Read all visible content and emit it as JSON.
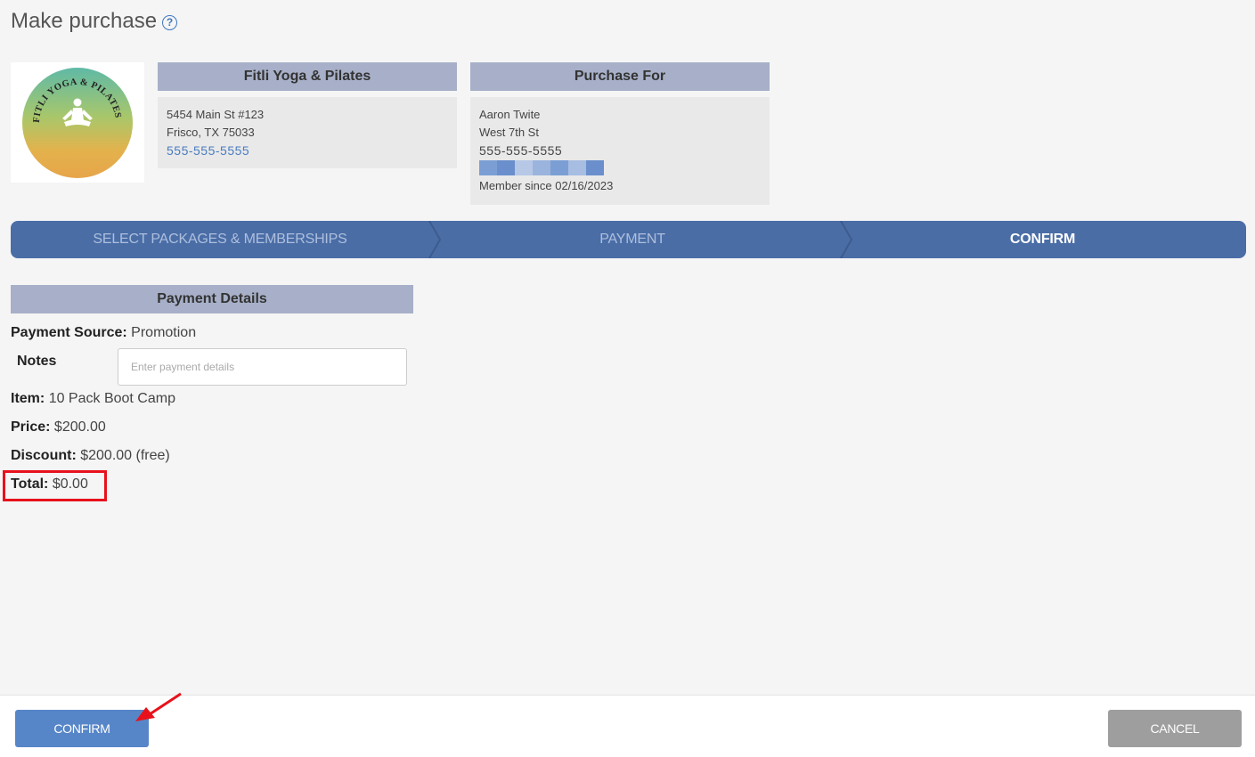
{
  "page": {
    "title": "Make purchase",
    "help_icon": "question-circle-icon"
  },
  "studio": {
    "logo_text": "FITLI YOGA & PILATES",
    "header": "Fitli Yoga & Pilates",
    "address1": "5454 Main St #123",
    "address2": "Frisco, TX 75033",
    "phone": "555-555-5555"
  },
  "purchase_for": {
    "header": "Purchase For",
    "name": "Aaron Twite",
    "street": "West 7th St",
    "phone": "555-555-5555",
    "member_since": "Member since 02/16/2023"
  },
  "steps": [
    {
      "label": "SELECT PACKAGES & MEMBERSHIPS",
      "state": "completed"
    },
    {
      "label": "PAYMENT",
      "state": "completed"
    },
    {
      "label": "CONFIRM",
      "state": "active"
    }
  ],
  "payment_details": {
    "header": "Payment Details",
    "source_label": "Payment Source:",
    "source_value": "Promotion",
    "notes_label": "Notes",
    "notes_placeholder": "Enter payment details",
    "notes_value": "",
    "item_label": "Item:",
    "item_value": "10 Pack Boot Camp",
    "price_label": "Price:",
    "price_value": "$200.00",
    "discount_label": "Discount:",
    "discount_value": "$200.00",
    "discount_note": "(free)",
    "total_label": "Total:",
    "total_value": "$0.00"
  },
  "footer": {
    "confirm_label": "CONFIRM",
    "cancel_label": "CANCEL"
  },
  "colors": {
    "accent": "#4a6da6",
    "header_band": "#a7b0c8",
    "highlight": "#e8111b",
    "confirm_button": "#5786c8",
    "cancel_button": "#9e9e9e",
    "link": "#4a7cc0"
  }
}
